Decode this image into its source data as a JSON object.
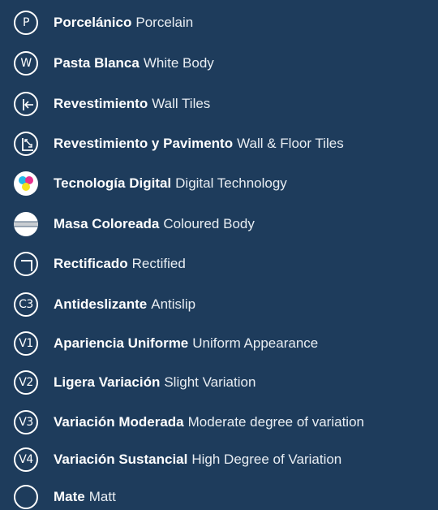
{
  "items": [
    {
      "icon": "letter-circle-icon",
      "icon_text": "P",
      "es": "Porcelánico",
      "en": "Porcelain"
    },
    {
      "icon": "letter-circle-icon",
      "icon_text": "W",
      "es": "Pasta Blanca",
      "en": "White Body"
    },
    {
      "icon": "wall-tile-arrow-icon",
      "es": "Revestimiento",
      "en": "Wall Tiles"
    },
    {
      "icon": "wall-floor-tile-arrow-icon",
      "es": "Revestimiento y Pavimento",
      "en": "Wall & Floor Tiles"
    },
    {
      "icon": "cmyk-dots-icon",
      "es": "Tecnología Digital",
      "en": "Digital Technology"
    },
    {
      "icon": "coloured-body-icon",
      "es": "Masa Coloreada",
      "en": "Coloured Body"
    },
    {
      "icon": "rectified-corner-icon",
      "es": "Rectificado",
      "en": "Rectified"
    },
    {
      "icon": "letter-circle-icon",
      "icon_text": "C3",
      "es": "Antideslizante",
      "en": "Antislip"
    },
    {
      "icon": "letter-circle-icon",
      "icon_text": "V1",
      "es": "Apariencia Uniforme",
      "en": "Uniform Appearance"
    },
    {
      "icon": "letter-circle-icon",
      "icon_text": "V2",
      "es": "Ligera Variación",
      "en": "Slight Variation"
    },
    {
      "icon": "letter-circle-icon",
      "icon_text": "V3",
      "es": "Variación Moderada",
      "en": "Moderate degree of variation"
    },
    {
      "icon": "letter-circle-icon",
      "icon_text": "V4",
      "es": "Variación Sustancial",
      "en": "High Degree of Variation"
    },
    {
      "icon": "matt-circle-icon",
      "es": "Mate",
      "en": "Matt"
    }
  ],
  "colors": {
    "background": "#1e3c5c",
    "text": "#ffffff",
    "cyan": "#22b6e8",
    "magenta": "#e8308e",
    "yellow": "#f6e21c"
  }
}
